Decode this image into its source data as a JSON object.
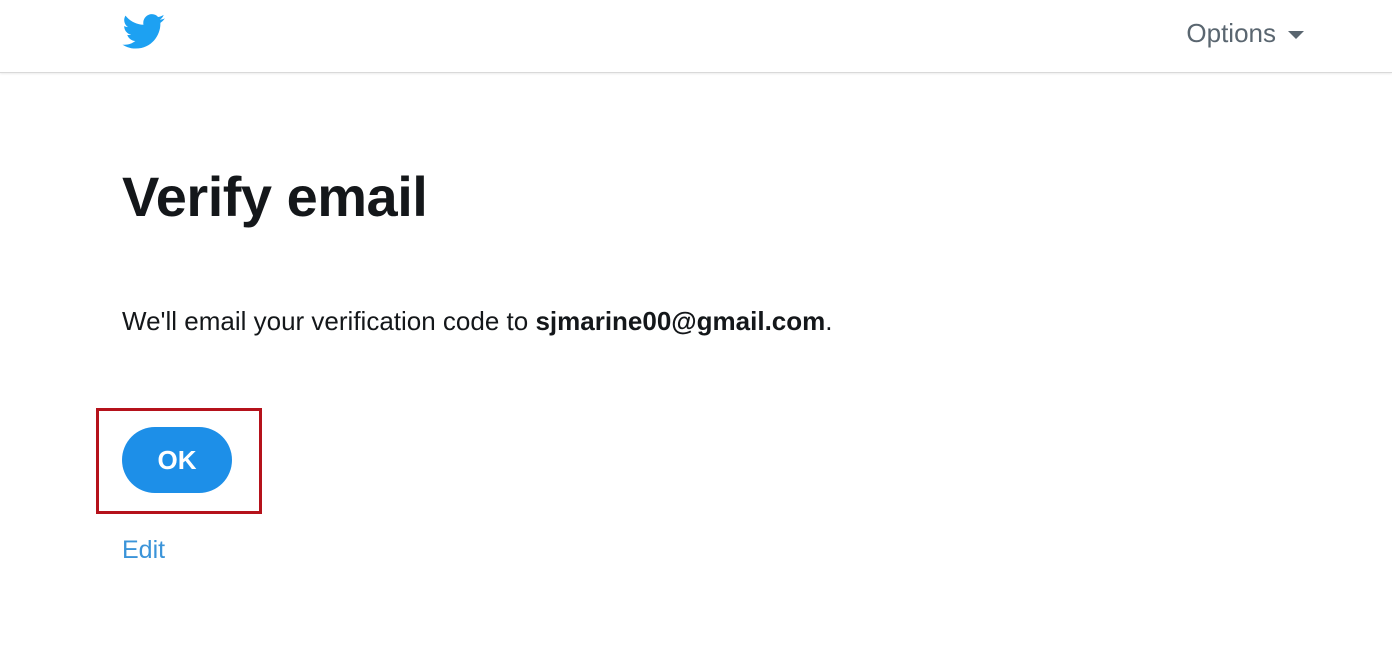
{
  "header": {
    "logo_icon": "twitter-bird-icon",
    "brand_color": "#1da1f2",
    "options_label": "Options",
    "options_icon": "caret-down-icon"
  },
  "main": {
    "title": "Verify email",
    "message_prefix": "We'll email your verification code to ",
    "email": "sjmarine00@gmail.com",
    "message_suffix": ".",
    "ok_label": "OK",
    "edit_label": "Edit"
  },
  "colors": {
    "primary_button": "#1d8fe8",
    "link": "#3b94d9",
    "highlight": "#b5121b",
    "text": "#14171a"
  }
}
